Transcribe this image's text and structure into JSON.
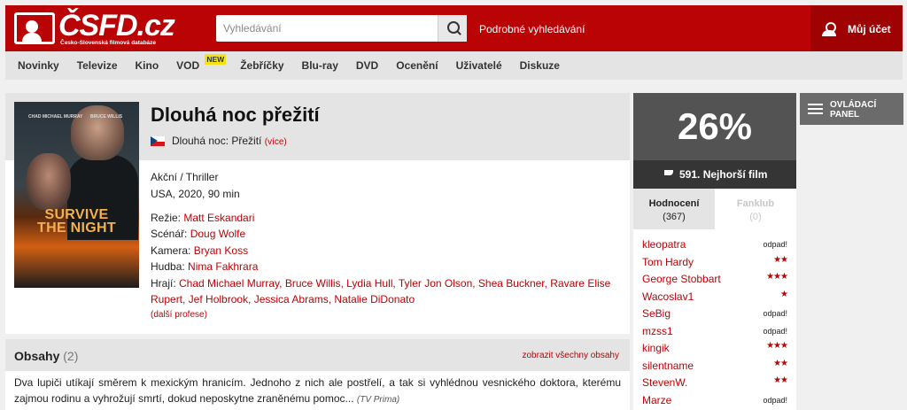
{
  "header": {
    "logo_text": "ČSFD.cz",
    "logo_subtitle": "Česko-Slovenská filmová databáze",
    "search_placeholder": "Vyhledávání",
    "advanced_search": "Podrobné vyhledávání",
    "account_label": "Můj účet",
    "colors": {
      "brand": "#ba0305",
      "accent_dark": "#9e0203"
    }
  },
  "nav": {
    "items": [
      "Novinky",
      "Televize",
      "Kino",
      "VOD",
      "Žebříčky",
      "Blu-ray",
      "DVD",
      "Ocenění",
      "Uživatelé",
      "Diskuze"
    ],
    "vod_badge": "NEW"
  },
  "film": {
    "title": "Dlouhá noc přežití",
    "alt_title": "Dlouhá noc: Přežití",
    "alt_more": "(více)",
    "genres": "Akční / Thriller",
    "origin": "USA, 2020, 90 min",
    "director_label": "Režie:",
    "director": "Matt Eskandari",
    "writer_label": "Scénář:",
    "writer": "Doug Wolfe",
    "camera_label": "Kamera:",
    "camera": "Bryan Koss",
    "music_label": "Hudba:",
    "music": "Nima Fakhrara",
    "cast_label": "Hrají:",
    "cast": "Chad Michael Murray, Bruce Willis, Lydia Hull, Tyler Jon Olson, Shea Buckner, Ravare Elise Rupert, Jef Holbrook, Jessica Abrams, Natalie DiDonato",
    "more_professions": "(další profese)",
    "poster": {
      "title_line1": "SURVIVE",
      "title_line2": "THE NIGHT",
      "actor1": "CHAD MICHAEL MURRAY",
      "actor2": "BRUCE WILLIS"
    }
  },
  "plots": {
    "title": "Obsahy",
    "count": "(2)",
    "show_all": "zobrazit všechny obsahy",
    "text": "Dva lupiči utíkají směrem k mexickým hranicím. Jednoho z nich ale postřelí, a tak si vyhlédnou vesnického doktora, kterému zajmou rodinu a vyhrožují smrtí, dokud neposkytne zraněnému pomoc...",
    "source": "(TV Prima)"
  },
  "rating": {
    "percent": "26%",
    "rank_label": "591. Nejhorší film",
    "tab_ratings": "Hodnocení",
    "tab_ratings_count": "(367)",
    "tab_fanclub": "Fanklub",
    "tab_fanclub_count": "(0)",
    "raters": [
      {
        "name": "kleopatra",
        "verdict": "odpad!",
        "stars": ""
      },
      {
        "name": "Tom Hardy",
        "verdict": "",
        "stars": "★★"
      },
      {
        "name": "George Stobbart",
        "verdict": "",
        "stars": "★★★"
      },
      {
        "name": "Wacoslav1",
        "verdict": "",
        "stars": "★"
      },
      {
        "name": "SeBig",
        "verdict": "odpad!",
        "stars": ""
      },
      {
        "name": "mzss1",
        "verdict": "odpad!",
        "stars": ""
      },
      {
        "name": "kingik",
        "verdict": "",
        "stars": "★★★"
      },
      {
        "name": "silentname",
        "verdict": "",
        "stars": "★★"
      },
      {
        "name": "StevenW.",
        "verdict": "",
        "stars": "★★"
      },
      {
        "name": "Marze",
        "verdict": "odpad!",
        "stars": ""
      }
    ]
  },
  "panel": {
    "label": "OVLÁDACÍ PANEL"
  }
}
